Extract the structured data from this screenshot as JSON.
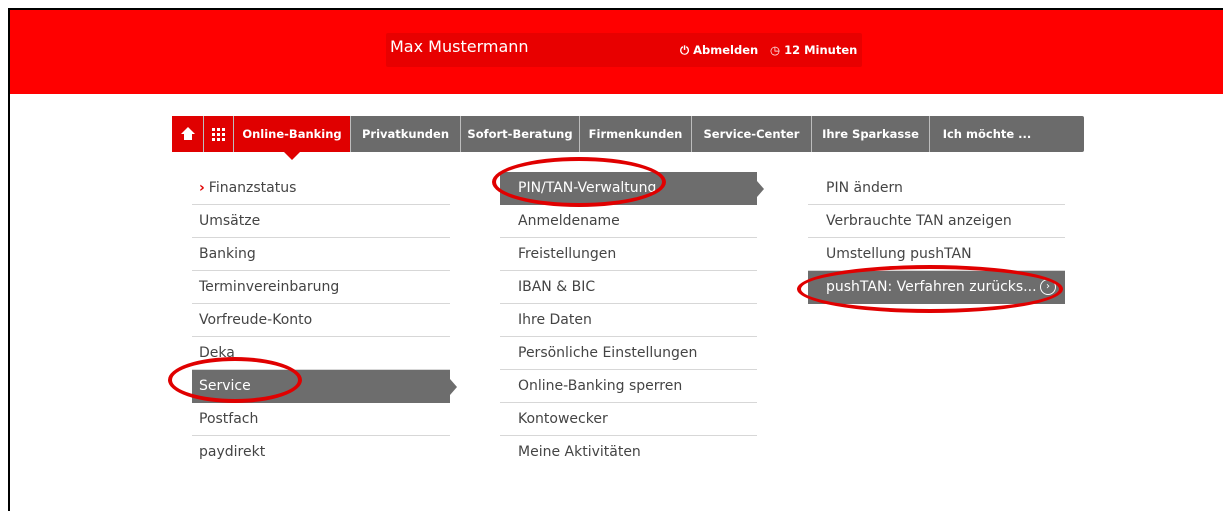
{
  "header": {
    "user_name": "Max Mustermann",
    "logout_label": "Abmelden",
    "session_timer": "12 Minuten"
  },
  "nav": {
    "items": [
      {
        "label": "",
        "icon": "home-icon"
      },
      {
        "label": "",
        "icon": "grid-icon"
      },
      {
        "label": "Online-Banking",
        "active": true
      },
      {
        "label": "Privatkunden"
      },
      {
        "label": "Sofort-Beratung"
      },
      {
        "label": "Firmenkunden"
      },
      {
        "label": "Service-Center"
      },
      {
        "label": "Ihre Sparkasse"
      },
      {
        "label": "Ich möchte ..."
      }
    ]
  },
  "menu": {
    "level1": [
      {
        "label": "Finanzstatus"
      },
      {
        "label": "Umsätze"
      },
      {
        "label": "Banking"
      },
      {
        "label": "Terminvereinbarung"
      },
      {
        "label": "Vorfreude-Konto"
      },
      {
        "label": "Deka"
      },
      {
        "label": "Service",
        "selected": true
      },
      {
        "label": "Postfach"
      },
      {
        "label": "paydirekt"
      }
    ],
    "level2": [
      {
        "label": "PIN/TAN-Verwaltung",
        "selected": true
      },
      {
        "label": "Anmeldename"
      },
      {
        "label": "Freistellungen"
      },
      {
        "label": "IBAN & BIC"
      },
      {
        "label": "Ihre Daten"
      },
      {
        "label": "Persönliche Einstellungen"
      },
      {
        "label": "Online-Banking sperren"
      },
      {
        "label": "Kontowecker"
      },
      {
        "label": "Meine Aktivitäten"
      }
    ],
    "level3": [
      {
        "label": "PIN ändern"
      },
      {
        "label": "Verbrauchte TAN anzeigen"
      },
      {
        "label": "Umstellung pushTAN"
      },
      {
        "label": "pushTAN: Verfahren zurücks...",
        "selected": true
      }
    ]
  },
  "colors": {
    "brand_red": "#ff0000",
    "nav_gray": "#6b6b6b",
    "annotation_red": "#e00000"
  }
}
